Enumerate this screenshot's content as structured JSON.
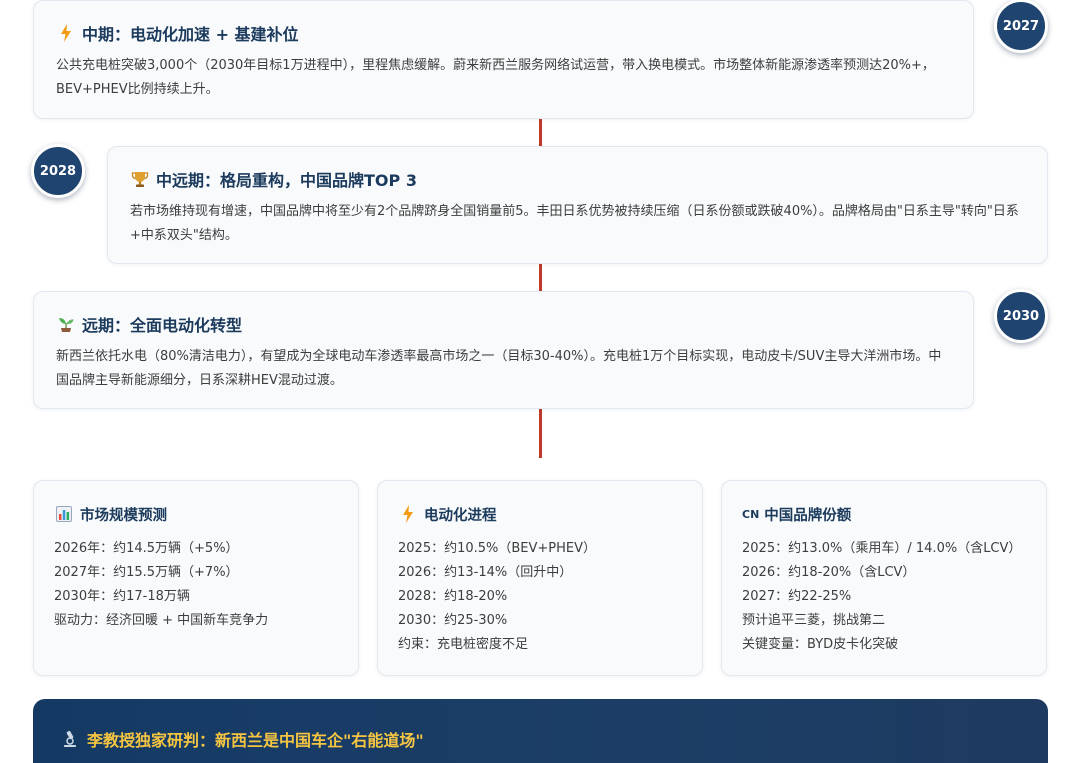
{
  "timeline": [
    {
      "year": "2027",
      "icon": "lightning-icon",
      "title": "中期：电动化加速 + 基建补位",
      "body": "公共充电桩突破3,000个（2030年目标1万进程中），里程焦虑缓解。蔚来新西兰服务网络试运营，带入换电模式。市场整体新能源渗透率预测达20%+，BEV+PHEV比例持续上升。"
    },
    {
      "year": "2028",
      "icon": "trophy-icon",
      "title": "中远期：格局重构，中国品牌TOP 3",
      "body": "若市场维持现有增速，中国品牌中将至少有2个品牌跻身全国销量前5。丰田日系优势被持续压缩（日系份额或跌破40%）。品牌格局由\"日系主导\"转向\"日系+中系双头\"结构。"
    },
    {
      "year": "2030",
      "icon": "sprout-icon",
      "title": "远期：全面电动化转型",
      "body": "新西兰依托水电（80%清洁电力），有望成为全球电动车渗透率最高市场之一（目标30-40%）。充电桩1万个目标实现，电动皮卡/SUV主导大洋洲市场。中国品牌主导新能源细分，日系深耕HEV混动过渡。"
    }
  ],
  "summary": [
    {
      "icon": "bar-chart-icon",
      "title": "市场规模预测",
      "items": [
        "2026年：约14.5万辆（+5%）",
        "2027年：约15.5万辆（+7%）",
        "2030年：约17-18万辆",
        "驱动力：经济回暖 + 中国新车竞争力"
      ]
    },
    {
      "icon": "lightning-icon",
      "title": "电动化进程",
      "items": [
        "2025：约10.5%（BEV+PHEV）",
        "2026：约13-14%（回升中）",
        "2028：约18-20%",
        "2030：约25-30%",
        "约束：充电桩密度不足"
      ]
    },
    {
      "icon": "cn-flag-icon",
      "icon_text": "CN",
      "title": "中国品牌份额",
      "items": [
        "2025：约13.0%（乘用车）/ 14.0%（含LCV）",
        "2026：约18-20%（含LCV）",
        "2027：约22-25%",
        "预计追平三菱，挑战第二",
        "关键变量：BYD皮卡化突破"
      ]
    }
  ],
  "banner": {
    "icon": "microscope-icon",
    "title": "李教授独家研判：新西兰是中国车企\"右能道场\""
  },
  "colors": {
    "accent_line": "#c0392b",
    "badge_bg": "#1f4470",
    "title_navy": "#1b3a5c",
    "banner_title": "#f5c542"
  }
}
